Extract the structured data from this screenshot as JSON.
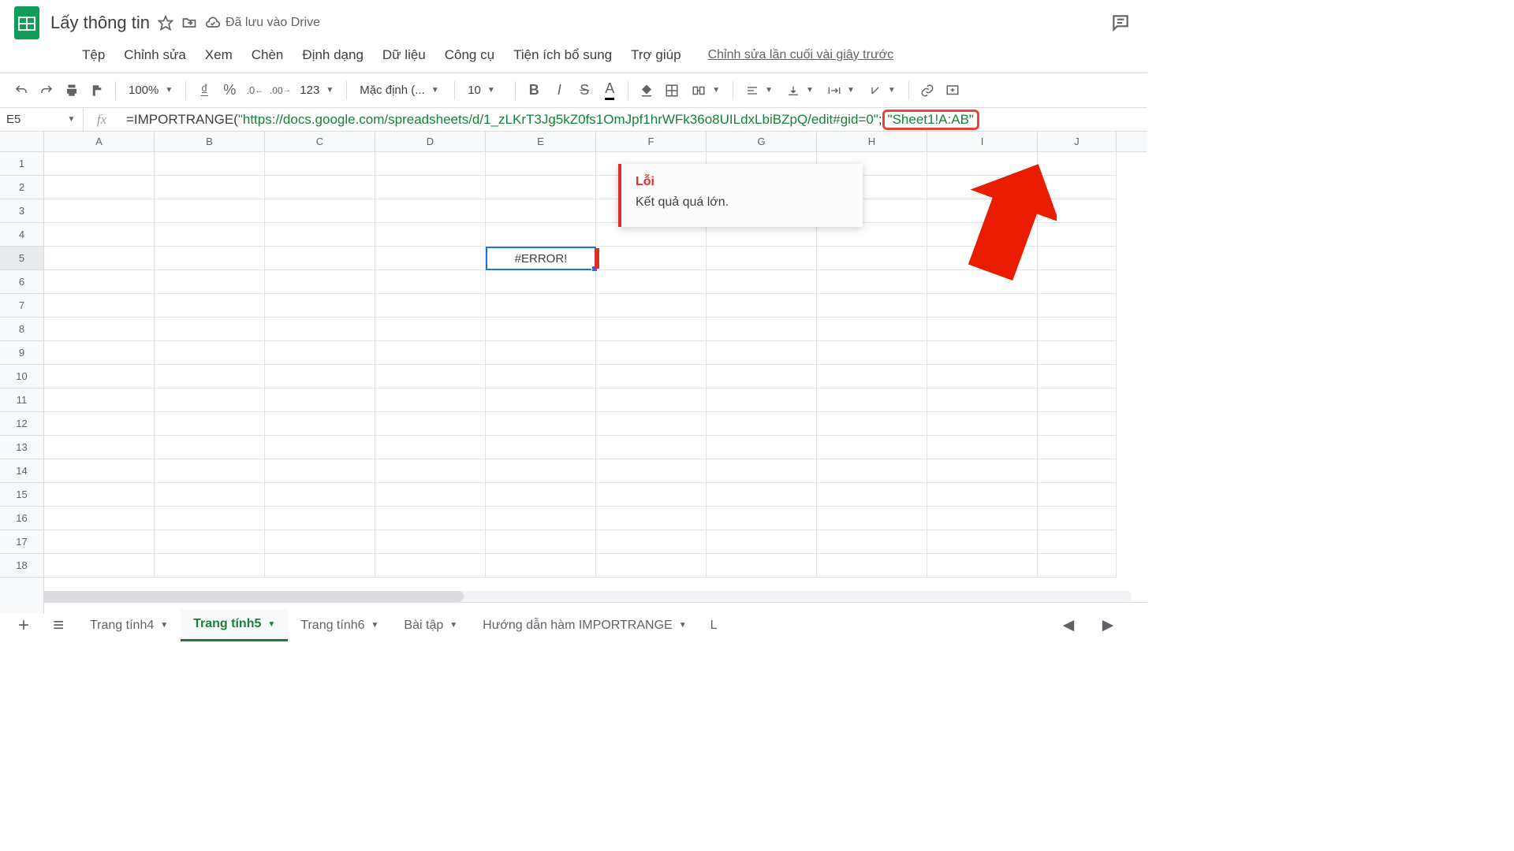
{
  "doc": {
    "title": "Lấy thông tin",
    "drive_status": "Đã lưu vào Drive"
  },
  "menu": {
    "items": [
      "Tệp",
      "Chỉnh sửa",
      "Xem",
      "Chèn",
      "Định dạng",
      "Dữ liệu",
      "Công cụ",
      "Tiện ích bổ sung",
      "Trợ giúp"
    ],
    "last_edit": "Chỉnh sửa lần cuối vài giây trước"
  },
  "toolbar": {
    "zoom": "100%",
    "currency": "₫",
    "percent": "%",
    "dec_dec": ".0",
    "inc_dec": ".00",
    "more_formats": "123",
    "font": "Mặc định (...",
    "font_size": "10"
  },
  "name_box": "E5",
  "formula": {
    "prefix": "=IMPORTRANGE(",
    "arg1": "\"https://docs.google.com/spreadsheets/d/1_zLKrT3Jg5kZ0fs1OmJpf1hrWFk36o8UILdxLbiBZpQ/edit#gid=0\"",
    "sep": ";",
    "arg2": "\"Sheet1!A:AB\""
  },
  "columns": [
    "A",
    "B",
    "C",
    "D",
    "E",
    "F",
    "G",
    "H",
    "I",
    "J"
  ],
  "rows": [
    1,
    2,
    3,
    4,
    5,
    6,
    7,
    8,
    9,
    10,
    11,
    12,
    13,
    14,
    15,
    16,
    17,
    18
  ],
  "selected": {
    "ref": "E5",
    "row": 5,
    "col": "E",
    "value": "#ERROR!"
  },
  "error_popup": {
    "title": "Lỗi",
    "message": "Kết quả quá lớn."
  },
  "sheets": {
    "tabs": [
      {
        "label": "Trang tính4",
        "active": false
      },
      {
        "label": "Trang tính5",
        "active": true
      },
      {
        "label": "Trang tính6",
        "active": false
      },
      {
        "label": "Bài tập",
        "active": false
      },
      {
        "label": "Hướng dẫn hàm IMPORTRANGE",
        "active": false
      }
    ],
    "overflow_hint": "L"
  }
}
